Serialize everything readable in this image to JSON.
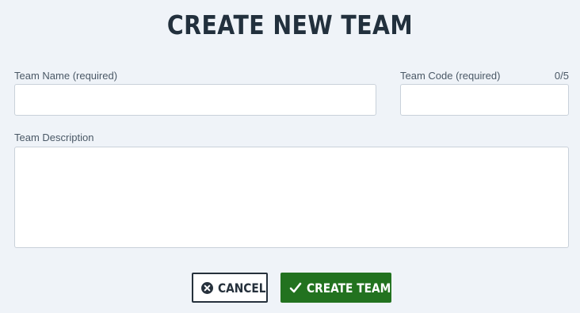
{
  "page": {
    "title": "CREATE NEW TEAM"
  },
  "form": {
    "team_name": {
      "label": "Team Name (required)",
      "value": ""
    },
    "team_code": {
      "label": "Team Code (required)",
      "value": "",
      "counter": "0/5"
    },
    "team_description": {
      "label": "Team Description",
      "value": ""
    }
  },
  "actions": {
    "cancel_label": "CANCEL",
    "cancel_icon": "close-circle-icon",
    "create_label": "CREATE TEAM",
    "create_icon": "checkmark-icon"
  },
  "colors": {
    "background": "#eff3f8",
    "primary_green": "#22721f",
    "dark_text": "#22303d"
  }
}
